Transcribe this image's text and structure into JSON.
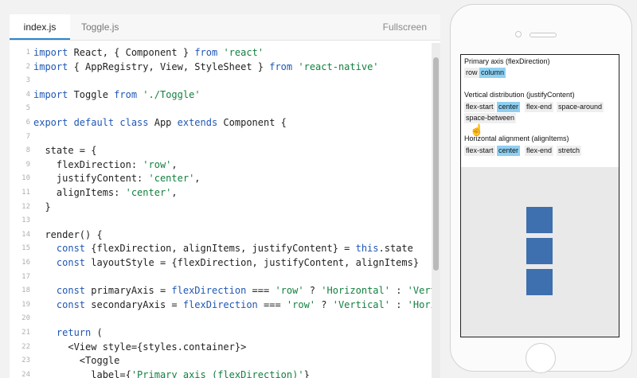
{
  "editor": {
    "tabs": [
      {
        "label": "index.js"
      },
      {
        "label": "Toggle.js"
      }
    ],
    "fullscreen_label": "Fullscreen",
    "lines": [
      {
        "n": "1",
        "parts": [
          [
            "kw",
            "import"
          ],
          [
            "tx",
            " React, { Component } "
          ],
          [
            "kw",
            "from"
          ],
          [
            "tx",
            " "
          ],
          [
            "str",
            "'react'"
          ]
        ]
      },
      {
        "n": "2",
        "parts": [
          [
            "kw",
            "import"
          ],
          [
            "tx",
            " { AppRegistry, View, StyleSheet } "
          ],
          [
            "kw",
            "from"
          ],
          [
            "tx",
            " "
          ],
          [
            "str",
            "'react-native'"
          ]
        ]
      },
      {
        "n": "3",
        "parts": []
      },
      {
        "n": "4",
        "parts": [
          [
            "kw",
            "import"
          ],
          [
            "tx",
            " Toggle "
          ],
          [
            "kw",
            "from"
          ],
          [
            "tx",
            " "
          ],
          [
            "str",
            "'./Toggle'"
          ]
        ]
      },
      {
        "n": "5",
        "parts": []
      },
      {
        "n": "6",
        "parts": [
          [
            "kw",
            "export default class"
          ],
          [
            "tx",
            " App "
          ],
          [
            "kw",
            "extends"
          ],
          [
            "tx",
            " Component {"
          ]
        ]
      },
      {
        "n": "7",
        "parts": []
      },
      {
        "n": "8",
        "parts": [
          [
            "tx",
            "  state = {"
          ]
        ]
      },
      {
        "n": "9",
        "parts": [
          [
            "tx",
            "    flexDirection: "
          ],
          [
            "str",
            "'row'"
          ],
          [
            "tx",
            ","
          ]
        ]
      },
      {
        "n": "10",
        "parts": [
          [
            "tx",
            "    justifyContent: "
          ],
          [
            "str",
            "'center'"
          ],
          [
            "tx",
            ","
          ]
        ]
      },
      {
        "n": "11",
        "parts": [
          [
            "tx",
            "    alignItems: "
          ],
          [
            "str",
            "'center'"
          ],
          [
            "tx",
            ","
          ]
        ]
      },
      {
        "n": "12",
        "parts": [
          [
            "tx",
            "  }"
          ]
        ]
      },
      {
        "n": "13",
        "parts": []
      },
      {
        "n": "14",
        "parts": [
          [
            "tx",
            "  render() {"
          ]
        ]
      },
      {
        "n": "15",
        "parts": [
          [
            "tx",
            "    "
          ],
          [
            "kw",
            "const"
          ],
          [
            "tx",
            " {flexDirection, alignItems, justifyContent} = "
          ],
          [
            "kw",
            "this"
          ],
          [
            "tx",
            ".state"
          ]
        ]
      },
      {
        "n": "16",
        "parts": [
          [
            "tx",
            "    "
          ],
          [
            "kw",
            "const"
          ],
          [
            "tx",
            " layoutStyle = {flexDirection, justifyContent, alignItems}"
          ]
        ]
      },
      {
        "n": "17",
        "parts": []
      },
      {
        "n": "18",
        "parts": [
          [
            "tx",
            "    "
          ],
          [
            "kw",
            "const"
          ],
          [
            "tx",
            " primaryAxis = "
          ],
          [
            "kw",
            "flexDirection"
          ],
          [
            "tx",
            " === "
          ],
          [
            "str",
            "'row'"
          ],
          [
            "tx",
            " ? "
          ],
          [
            "str",
            "'Horizontal'"
          ],
          [
            "tx",
            " : "
          ],
          [
            "str",
            "'Vertica"
          ]
        ]
      },
      {
        "n": "19",
        "parts": [
          [
            "tx",
            "    "
          ],
          [
            "kw",
            "const"
          ],
          [
            "tx",
            " secondaryAxis = "
          ],
          [
            "kw",
            "flexDirection"
          ],
          [
            "tx",
            " === "
          ],
          [
            "str",
            "'row'"
          ],
          [
            "tx",
            " ? "
          ],
          [
            "str",
            "'Vertical'"
          ],
          [
            "tx",
            " : "
          ],
          [
            "str",
            "'Horizon"
          ]
        ]
      },
      {
        "n": "20",
        "parts": []
      },
      {
        "n": "21",
        "parts": [
          [
            "tx",
            "    "
          ],
          [
            "kw",
            "return"
          ],
          [
            "tx",
            " ("
          ]
        ]
      },
      {
        "n": "22",
        "parts": [
          [
            "tx",
            "      <View style={styles.container}>"
          ]
        ]
      },
      {
        "n": "23",
        "parts": [
          [
            "tx",
            "        <Toggle"
          ]
        ]
      },
      {
        "n": "24",
        "parts": [
          [
            "tx",
            "          label={"
          ],
          [
            "str",
            "'Primary axis (flexDirection)'"
          ],
          [
            "tx",
            "}"
          ]
        ]
      }
    ]
  },
  "preview": {
    "sections": [
      {
        "title": "Primary axis (flexDirection)",
        "options": [
          "row",
          "column"
        ],
        "selected": 1
      },
      {
        "title": "Vertical distribution (justifyContent)",
        "options": [
          "flex-start",
          "center",
          "flex-end",
          "space-around",
          "space-between"
        ],
        "selected": 1
      },
      {
        "title": "Horizontal alignment (alignItems)",
        "options": [
          "flex-start",
          "center",
          "flex-end",
          "stretch"
        ],
        "selected": 1
      }
    ],
    "box_color": "#3e6fae",
    "selected_color": "#8fd0f2",
    "box_count": 3
  }
}
